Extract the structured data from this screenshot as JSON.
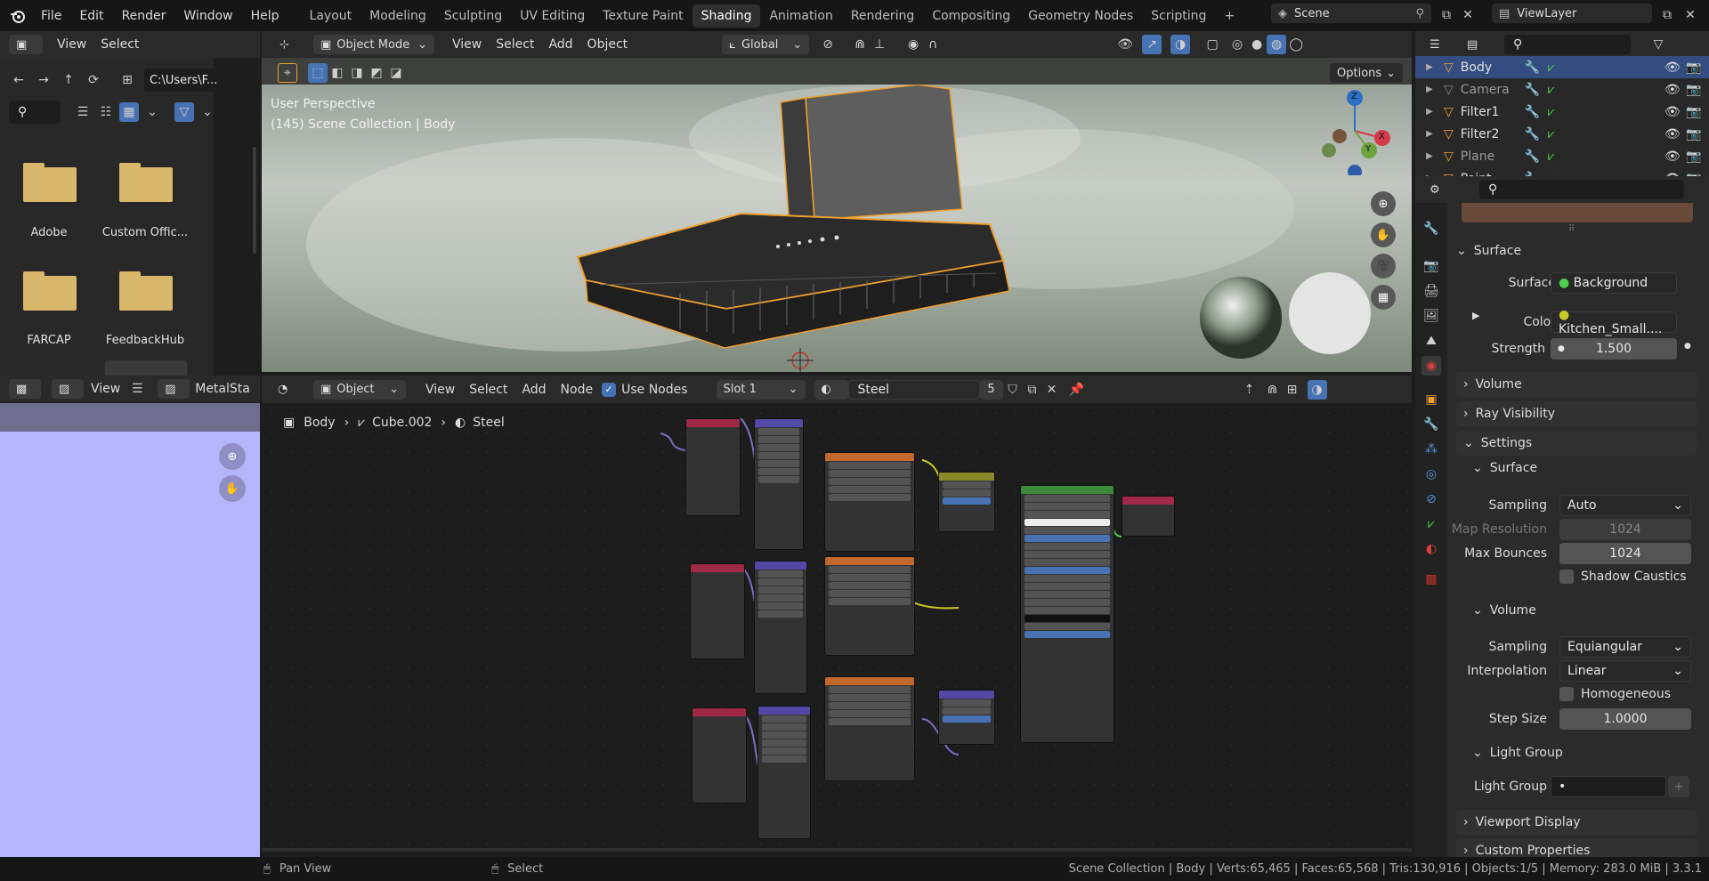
{
  "menubar": {
    "menus": [
      "File",
      "Edit",
      "Render",
      "Window",
      "Help"
    ],
    "workspaces": [
      "Layout",
      "Modeling",
      "Sculpting",
      "UV Editing",
      "Texture Paint",
      "Shading",
      "Animation",
      "Rendering",
      "Compositing",
      "Geometry Nodes",
      "Scripting"
    ],
    "active_workspace": "Shading",
    "add_tab": "+",
    "scene": "Scene",
    "view_layer": "ViewLayer"
  },
  "file_browser": {
    "header": {
      "view": "View",
      "select": "Select"
    },
    "path": "C:\\Users\\F...",
    "folders": [
      "Adobe",
      "Custom Offic...",
      "FARCAP",
      "FeedbackHub"
    ]
  },
  "image_editor": {
    "view": "View",
    "image_name": "MetalSta"
  },
  "viewport": {
    "mode": "Object Mode",
    "menus": [
      "View",
      "Select",
      "Add",
      "Object"
    ],
    "transform_orientation": "Global",
    "options": "Options",
    "info_line1": "User Perspective",
    "info_line2": "(145) Scene Collection | Body",
    "gizmo": {
      "x": "X",
      "y": "Y",
      "z": "Z"
    }
  },
  "node_editor": {
    "type": "Object",
    "menus": [
      "View",
      "Select",
      "Add",
      "Node"
    ],
    "use_nodes": "Use Nodes",
    "slot": "Slot 1",
    "material": "Steel",
    "users": "5",
    "breadcrumb": [
      "Body",
      "Cube.002",
      "Steel"
    ]
  },
  "outliner": {
    "items": [
      {
        "name": "Body",
        "selected": true
      },
      {
        "name": "Camera"
      },
      {
        "name": "Filter1"
      },
      {
        "name": "Filter2"
      },
      {
        "name": "Plane"
      },
      {
        "name": "Point"
      }
    ]
  },
  "properties": {
    "surface_panel": "Surface",
    "surface_label": "Surface",
    "surface_value": "Background",
    "color_label": "Color",
    "color_value": "Kitchen_Small....",
    "strength_label": "Strength",
    "strength_value": "1.500",
    "volume_panel": "Volume",
    "ray_visibility_panel": "Ray Visibility",
    "settings_panel": "Settings",
    "settings_surface": "Surface",
    "sampling_label": "Sampling",
    "sampling_value": "Auto",
    "map_res_label": "Map Resolution",
    "map_res_value": "1024",
    "max_bounces_label": "Max Bounces",
    "max_bounces_value": "1024",
    "shadow_caustics": "Shadow Caustics",
    "settings_volume": "Volume",
    "vol_sampling_label": "Sampling",
    "vol_sampling_value": "Equiangular",
    "interp_label": "Interpolation",
    "interp_value": "Linear",
    "homogeneous": "Homogeneous",
    "step_label": "Step Size",
    "step_value": "1.0000",
    "light_group_panel": "Light Group",
    "light_group_label": "Light Group",
    "light_group_value": "•",
    "viewport_display": "Viewport Display",
    "custom_props": "Custom Properties"
  },
  "statusbar": {
    "left": "Pan View",
    "mid": "Select",
    "stats": "Scene Collection | Body | Verts:65,465 | Faces:65,568 | Tris:130,916 | Objects:1/5 | Memory: 283.0 MiB | 3.3.1"
  },
  "colors": {
    "accent": "#4772b3",
    "selection_orange": "#f0a030",
    "folder": "#d8b66a"
  }
}
